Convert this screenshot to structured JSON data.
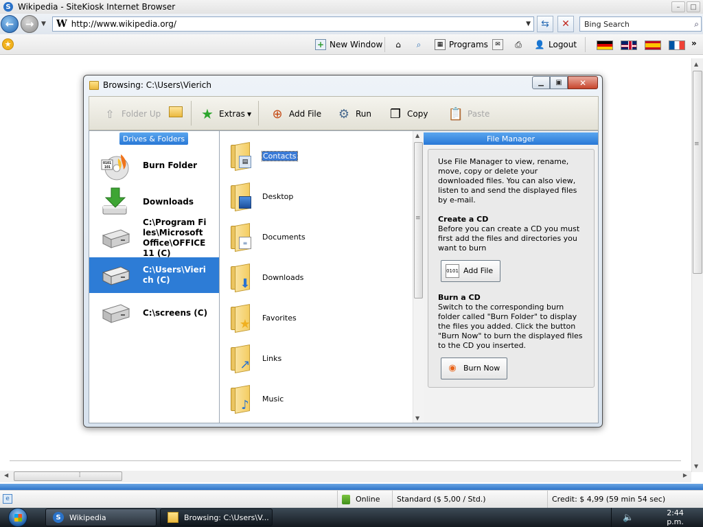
{
  "browser": {
    "window_title": "Wikipedia - SiteKiosk Internet Browser",
    "url": "http://www.wikipedia.org/",
    "search_placeholder": "Bing Search"
  },
  "kiosk_toolbar": {
    "new_window": "New Window",
    "programs": "Programs",
    "logout": "Logout",
    "more": "»",
    "flags": [
      "german-flag",
      "uk-flag",
      "spanish-flag",
      "french-flag"
    ]
  },
  "dialog": {
    "title": "Browsing: C:\\Users\\Vierich",
    "toolbar": {
      "folder_up": "Folder Up",
      "extras": "Extras",
      "add_file": "Add File",
      "run": "Run",
      "copy": "Copy",
      "paste": "Paste"
    },
    "left_header": "Drives & Folders",
    "drives": [
      {
        "label": "Burn Folder",
        "icon": "burn-cd-icon"
      },
      {
        "label": "Downloads",
        "icon": "download-arrow-icon"
      },
      {
        "label": "C:\\Program Files\\Microsoft Office\\OFFICE11 (C)",
        "icon": "hard-drive-icon"
      },
      {
        "label": "C:\\Users\\Vierich (C)",
        "icon": "hard-drive-icon",
        "selected": true
      },
      {
        "label": "C:\\screens (C)",
        "icon": "hard-drive-icon"
      }
    ],
    "folders": [
      {
        "label": "Contacts",
        "highlight": true
      },
      {
        "label": "Desktop"
      },
      {
        "label": "Documents"
      },
      {
        "label": "Downloads"
      },
      {
        "label": "Favorites"
      },
      {
        "label": "Links"
      },
      {
        "label": "Music"
      }
    ],
    "right_header": "File Manager",
    "file_manager": {
      "intro": "Use File Manager to view, rename, move, copy or delete your downloaded files. You can also view, listen to and send the displayed files by e-mail.",
      "create_heading": "Create a CD",
      "create_text": "Before you can create a CD you must first add the files and directories you want to burn",
      "add_file_button": "Add File",
      "burn_heading": "Burn a CD",
      "burn_text": "Switch to the corresponding burn folder called \"Burn Folder\" to display the files you added. Click the button \"Burn Now\" to burn the displayed files to the CD you inserted.",
      "burn_now_button": "Burn Now"
    }
  },
  "statusbar": {
    "online": "Online",
    "tariff": "Standard ($ 5,00 / Std.)",
    "credit": "Credit: $ 4,99 (59 min 54 sec)"
  },
  "taskbar": {
    "items": [
      "Wikipedia",
      "Browsing: C:\\Users\\V..."
    ],
    "clock": "2:44 p.m."
  },
  "colors": {
    "selection_blue": "#2d7cd6",
    "header_blue": "#2978d6",
    "status_blue": "#2e74c8"
  }
}
